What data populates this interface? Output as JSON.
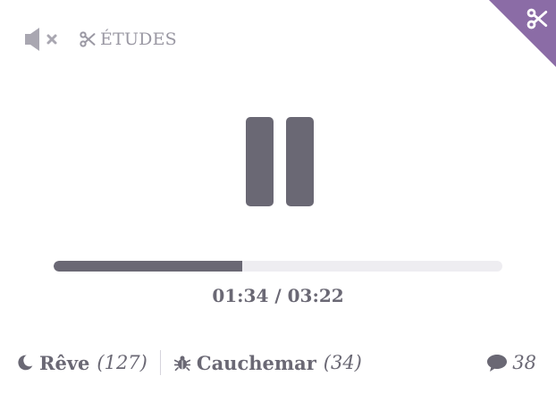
{
  "header": {
    "mute_icon": "speaker-muted-icon",
    "category_icon": "scissors-icon",
    "category_label": "ÉTUDES",
    "corner_icon": "scissors-icon",
    "corner_color": "#8b6ca6"
  },
  "player": {
    "state_icon": "pause-icon",
    "progress_fraction": 0.42,
    "elapsed": "01:34",
    "separator": "/",
    "duration": "03:22",
    "time_display": "01:34 / 03:22"
  },
  "votes": {
    "dream": {
      "icon": "moon-icon",
      "label": "Rêve",
      "count": "(127)"
    },
    "nightmare": {
      "icon": "bug-icon",
      "label": "Cauchemar",
      "count": "(34)"
    }
  },
  "comments": {
    "icon": "speech-bubble-icon",
    "count": "38"
  },
  "colors": {
    "accent": "#8b6ca6",
    "primary": "#6a6874",
    "track": "#eeedf1",
    "muted": "#9a98a3"
  }
}
